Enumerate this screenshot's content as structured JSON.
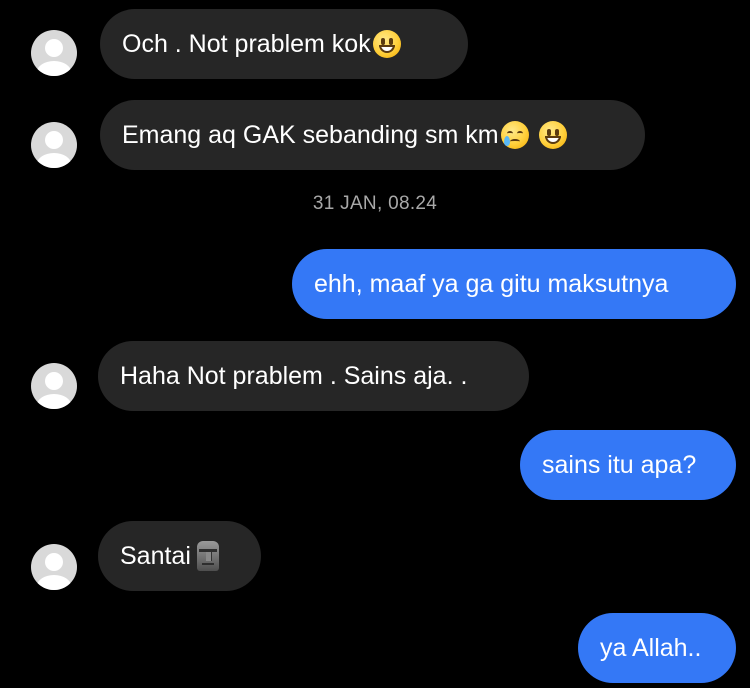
{
  "messages": [
    {
      "id": "m1",
      "direction": "incoming",
      "text": "Och . Not prablem kok",
      "emojis": [
        "grinning-face"
      ]
    },
    {
      "id": "m2",
      "direction": "incoming",
      "text": "Emang aq GAK sebanding sm km",
      "emojis": [
        "crying-face",
        "grinning-face"
      ]
    },
    {
      "id": "ts1",
      "type": "timestamp",
      "text": "31 JAN, 08.24"
    },
    {
      "id": "m3",
      "direction": "outgoing",
      "text": "ehh, maaf ya ga gitu maksutnya"
    },
    {
      "id": "m4",
      "direction": "incoming",
      "text": "Haha Not prablem . Sains aja. ."
    },
    {
      "id": "m5",
      "direction": "outgoing",
      "text": "sains itu apa?"
    },
    {
      "id": "m6",
      "direction": "incoming",
      "text": "Santai",
      "emojis": [
        "moai"
      ]
    },
    {
      "id": "m7",
      "direction": "outgoing",
      "text": "ya Allah.."
    }
  ],
  "timestamp": "31 JAN, 08.24",
  "colors": {
    "background": "#000000",
    "incoming_bubble": "#262626",
    "outgoing_bubble": "#3478f6",
    "timestamp_text": "#a8a8a8",
    "avatar": "#d9d9d9"
  },
  "icons": {
    "avatar": "default-avatar-icon",
    "grinning": "grinning-face-emoji",
    "crying": "crying-face-emoji",
    "moai": "moai-emoji"
  }
}
